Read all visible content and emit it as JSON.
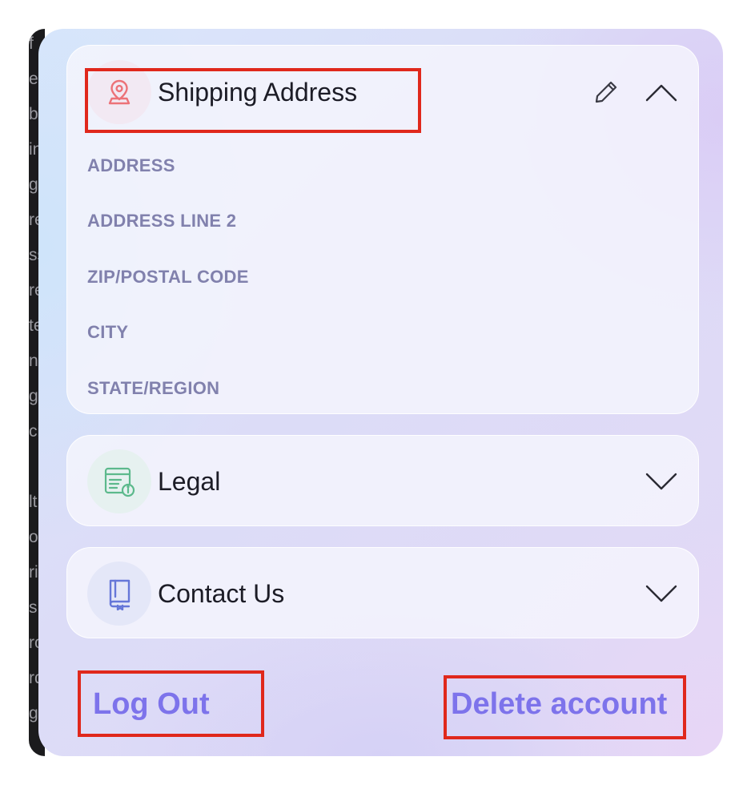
{
  "left_strip": {
    "fragments": [
      "f",
      "eb",
      "bo",
      "in",
      "gr",
      "re",
      "ss",
      "re",
      "te",
      "ne",
      "g",
      "cr",
      "",
      "lt",
      "or",
      "ri",
      "s",
      "ro",
      "rd",
      "g"
    ]
  },
  "shipping_address": {
    "title": "Shipping Address",
    "icon": "location-pin-icon",
    "expanded": true,
    "fields": [
      {
        "label": "ADDRESS",
        "value": ""
      },
      {
        "label": "ADDRESS LINE 2",
        "value": ""
      },
      {
        "label": "ZIP/POSTAL CODE",
        "value": ""
      },
      {
        "label": "CITY",
        "value": ""
      },
      {
        "label": "STATE/REGION",
        "value": ""
      }
    ]
  },
  "legal": {
    "title": "Legal",
    "icon": "legal-document-icon",
    "expanded": false
  },
  "contact_us": {
    "title": "Contact Us",
    "icon": "book-icon",
    "expanded": false
  },
  "actions": {
    "logout": "Log Out",
    "delete_account": "Delete account"
  },
  "colors": {
    "accent": "#7d73eb",
    "field_label": "#8181ad",
    "title_text": "#1c1c26",
    "highlight_box": "#e0281c",
    "pin_icon": "#ec7278",
    "legal_icon": "#5cb98c",
    "book_icon": "#6677d8"
  }
}
